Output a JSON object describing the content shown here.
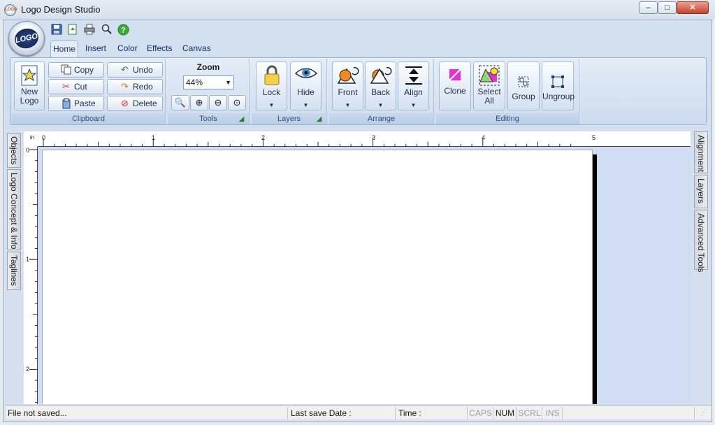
{
  "app": {
    "title": "Logo Design Studio",
    "orb_text": "LOGO",
    "icon_text": "LOGO"
  },
  "window": {
    "min": "–",
    "max": "□",
    "close": "✕"
  },
  "quick_access": [
    {
      "name": "save-icon",
      "glyph": "💾"
    },
    {
      "name": "export-icon",
      "glyph": "⇪"
    },
    {
      "name": "print-icon",
      "glyph": "⎙"
    },
    {
      "name": "preview-icon",
      "glyph": "🔍"
    },
    {
      "name": "help-icon",
      "glyph": "?"
    }
  ],
  "tabs": [
    "Home",
    "Insert",
    "Color",
    "Effects",
    "Canvas"
  ],
  "ribbon": {
    "clipboard": {
      "label": "Clipboard",
      "new_logo": "New\nLogo",
      "copy": "Copy",
      "cut": "Cut",
      "paste": "Paste",
      "undo": "Undo",
      "redo": "Redo",
      "delete": "Delete"
    },
    "tools": {
      "label": "Tools",
      "zoom_title": "Zoom",
      "zoom_value": "44%"
    },
    "layers": {
      "label": "Layers",
      "lock": "Lock",
      "hide": "Hide"
    },
    "arrange": {
      "label": "Arrange",
      "front": "Front",
      "back": "Back",
      "align": "Align"
    },
    "editing": {
      "label": "Editing",
      "clone": "Clone",
      "select_all": "Select\nAll",
      "group": "Group",
      "ungroup": "Ungroup"
    }
  },
  "left_tabs": [
    "Objects",
    "Logo Concept & Info",
    "Taglines"
  ],
  "right_tabs": [
    "Alignment",
    "Layers",
    "Advanced Tools"
  ],
  "ruler": {
    "unit": "in",
    "h_labels": [
      "0",
      "1",
      "2",
      "3",
      "4",
      "5"
    ],
    "v_labels": [
      "0",
      "1",
      "2"
    ]
  },
  "status": {
    "file": "File not saved...",
    "last_save": "Last save Date :",
    "time": "Time :",
    "caps": "CAPS",
    "num": "NUM",
    "scrl": "SCRL",
    "ins": "INS"
  }
}
